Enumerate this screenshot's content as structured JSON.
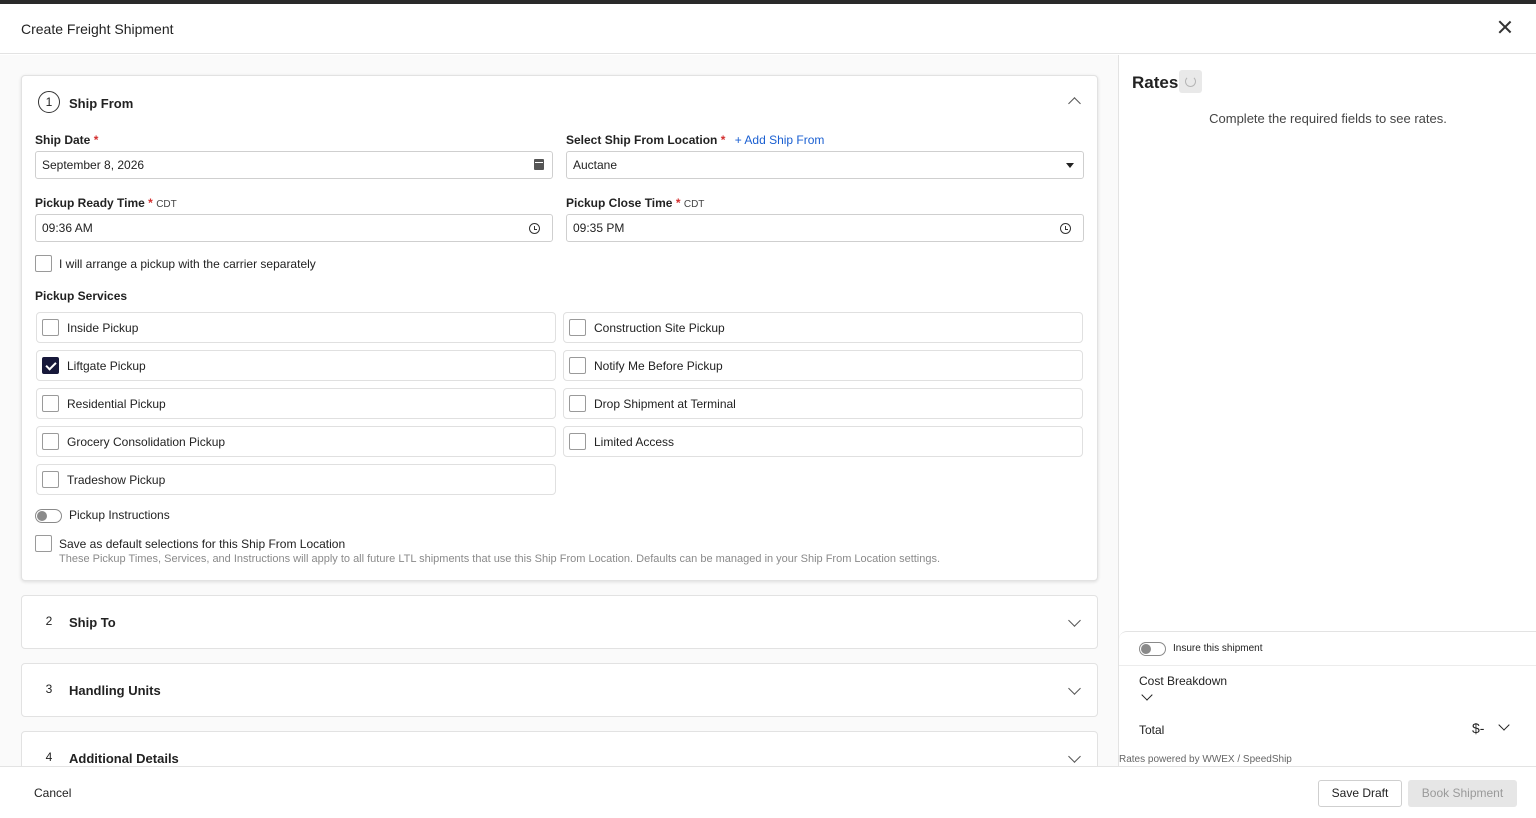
{
  "modal": {
    "title": "Create Freight Shipment"
  },
  "ship_from": {
    "number": "1",
    "title": "Ship From",
    "ship_date_label": "Ship Date",
    "ship_date_value": "September 8, 2026",
    "location_label": "Select Ship From Location",
    "add_location_link": "+ Add Ship From",
    "location_value": "Auctane",
    "pickup_ready_label": "Pickup Ready Time",
    "pickup_ready_tz": "CDT",
    "pickup_ready_value": "09:36 AM",
    "pickup_close_label": "Pickup Close Time",
    "pickup_close_tz": "CDT",
    "pickup_close_value": "09:35 PM",
    "arrange_separately_label": "I will arrange a pickup with the carrier separately",
    "arrange_separately_checked": false,
    "pickup_services_label": "Pickup Services",
    "services": [
      {
        "label": "Inside Pickup",
        "checked": false
      },
      {
        "label": "Construction Site Pickup",
        "checked": false
      },
      {
        "label": "Liftgate Pickup",
        "checked": true
      },
      {
        "label": "Notify Me Before Pickup",
        "checked": false
      },
      {
        "label": "Residential Pickup",
        "checked": false
      },
      {
        "label": "Drop Shipment at Terminal",
        "checked": false
      },
      {
        "label": "Grocery Consolidation Pickup",
        "checked": false
      },
      {
        "label": "Limited Access",
        "checked": false
      },
      {
        "label": "Tradeshow Pickup",
        "checked": false
      }
    ],
    "pickup_instructions_label": "Pickup Instructions",
    "pickup_instructions_on": false,
    "save_default_label": "Save as default selections for this Ship From Location",
    "save_default_checked": false,
    "save_default_hint": "These Pickup Times, Services, and Instructions will apply to all future LTL shipments that use this Ship From Location. Defaults can be managed in your Ship From Location settings."
  },
  "sections": [
    {
      "number": "2",
      "title": "Ship To"
    },
    {
      "number": "3",
      "title": "Handling Units"
    },
    {
      "number": "4",
      "title": "Additional Details"
    }
  ],
  "rates": {
    "title": "Rates",
    "message": "Complete the required fields to see rates.",
    "insure_label": "Insure this shipment",
    "insure_on": false,
    "cost_breakdown_label": "Cost Breakdown",
    "total_label": "Total",
    "total_value": "$-",
    "powered_by": "Rates powered by WWEX / SpeedShip"
  },
  "footer": {
    "cancel_label": "Cancel",
    "save_draft_label": "Save Draft",
    "book_label": "Book Shipment"
  },
  "colors": {
    "checkbox_checked": "#17183a",
    "link": "#1a5fd1",
    "required": "#d32f2f"
  },
  "icons": [
    "close-icon",
    "calendar-icon",
    "dropdown-caret-icon",
    "clock-icon",
    "chevron-up-icon",
    "chevron-down-icon",
    "refresh-icon"
  ]
}
